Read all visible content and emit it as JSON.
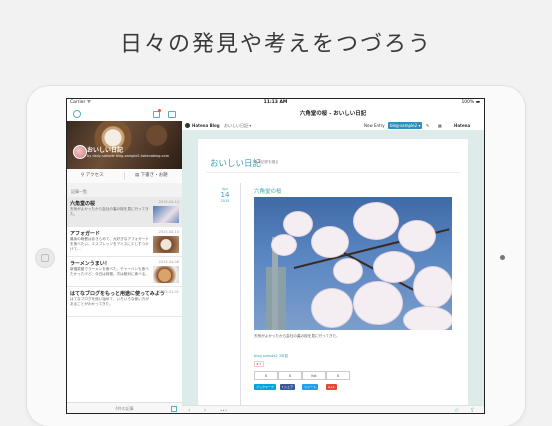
{
  "headline": "日々の発見や考えをつづろう",
  "status_bar": {
    "carrier": "Carrier ᯤ",
    "time": "11:13 AM",
    "battery": "100% ▬"
  },
  "left_pane": {
    "cover": {
      "blog_name": "おいしい日記",
      "blog_url": "by daily-sample  blog-sample2.hatenablog.com"
    },
    "actions": {
      "access": "アクセス",
      "subscribe": "下書き・お題"
    },
    "section_header": "記事一覧",
    "entries": [
      {
        "title": "六角堂の桜",
        "text": "天気がよかったから会社の裏の桜を見に行ってきた。",
        "date": "2015-04-14"
      },
      {
        "title": "アフォガード",
        "text": "最後の晩餐はあきらめて、大好きなアフォガードを食べたい。エスプレッソをアイスに少しずつかけて…",
        "date": "2015-04-10"
      },
      {
        "title": "ラーメンうまい！",
        "text": "新福菜館でラーメンを食べた。チャーハンも食べたかったけど、今日は我慢。次は絶対に食べる。",
        "date": "2015-04-08"
      },
      {
        "title": "はてなブログをもっと用途に使ってみよう",
        "text": "はてなブログを使い始めて、いろいろな使い方があることがわかってきた。",
        "date": "2015-01-01"
      }
    ],
    "bottom_label": "4件の記事"
  },
  "right_pane": {
    "nav_title": "六角堂の桜 - おいしい日記",
    "toolbar": {
      "brand": "Hatena Blog",
      "blog_dropdown": "おいしい日記 ▾",
      "new_entry": "New Entry",
      "blog_selector": "blog-sample2 ▾",
      "account": "Hatena"
    },
    "blog": {
      "title": "おいしい日記",
      "description": "食の記録を綴る"
    },
    "entry": {
      "month": "Apr",
      "day": "14",
      "year": "2015",
      "title": "六角堂の桜",
      "caption": "天気がよかったから会社の裏の桜を見に行ってきた。",
      "tag_link": "blog-sample2 3年前",
      "star_badge": "★+",
      "counters": [
        "0",
        "0",
        "list",
        "0"
      ],
      "share_buttons": [
        {
          "label": "ブックマーク",
          "color": "#00a4de"
        },
        {
          "label": "f シェア",
          "color": "#3b5998"
        },
        {
          "label": "ツイート",
          "color": "#1da1f2"
        },
        {
          "label": "G+1",
          "color": "#dd4b39"
        }
      ]
    },
    "bottom_icons": {
      "back": "‹",
      "forward": "›",
      "more": "•••",
      "star": "☆",
      "share": "⇪"
    }
  }
}
